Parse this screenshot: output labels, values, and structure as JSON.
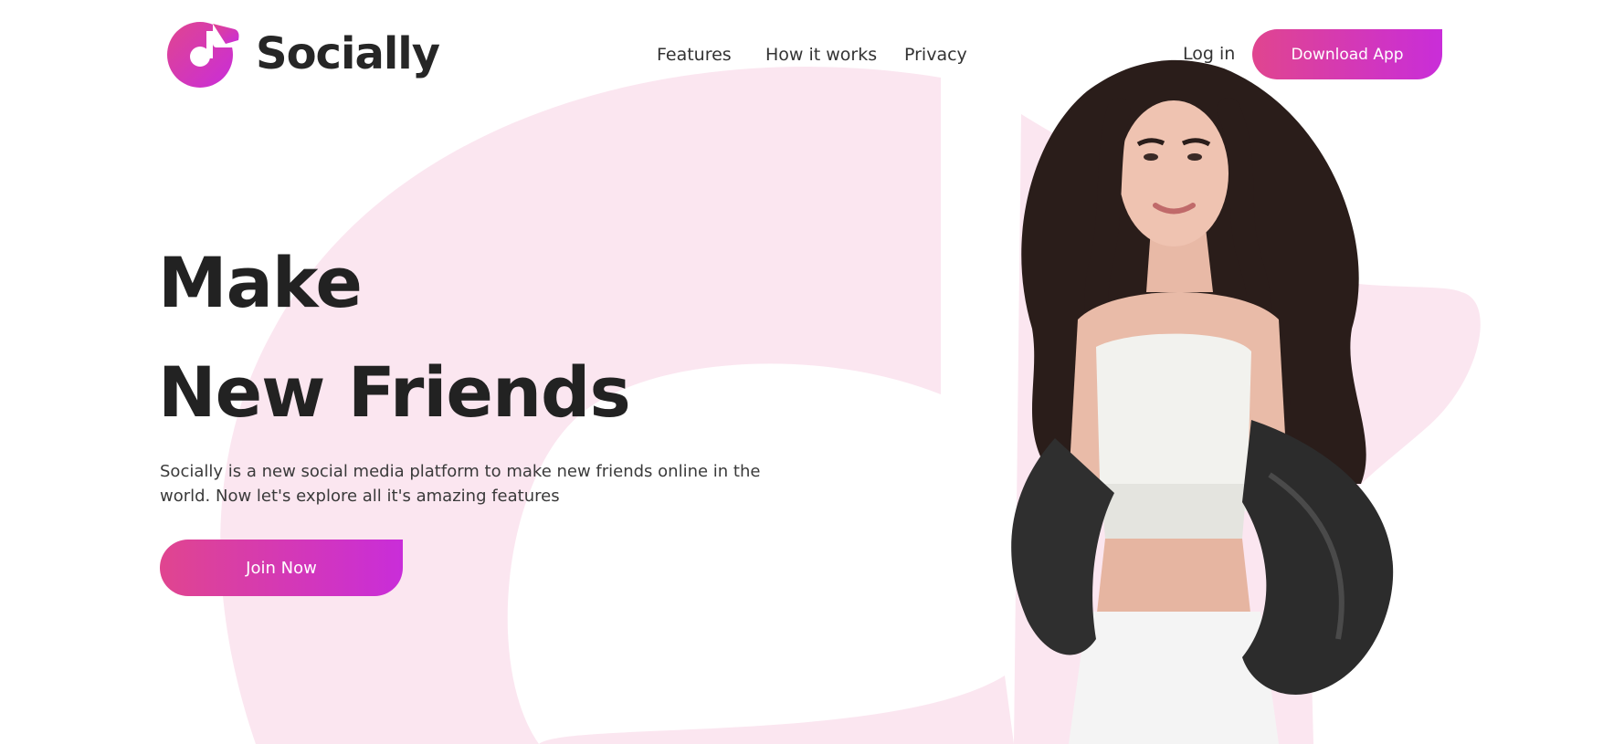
{
  "brand": {
    "name": "Socially",
    "colors": {
      "primary_start": "#e0458f",
      "primary_end": "#c92dd9",
      "background_shape": "#fbe6f0",
      "text_dark": "#222222"
    },
    "logo_icon": "music-note-logo-icon"
  },
  "nav": {
    "items": [
      {
        "label": "Features"
      },
      {
        "label": "How it works"
      },
      {
        "label": "Privacy"
      }
    ],
    "login_label": "Log in",
    "download_label": "Download App"
  },
  "hero": {
    "headline_line1": "Make",
    "headline_line2": "New Friends",
    "description": "Socially is a new social media platform to make new friends online in the world. Now let's explore all it's amazing features",
    "cta_label": "Join Now"
  },
  "image": {
    "subject": "hero-person-photo"
  }
}
